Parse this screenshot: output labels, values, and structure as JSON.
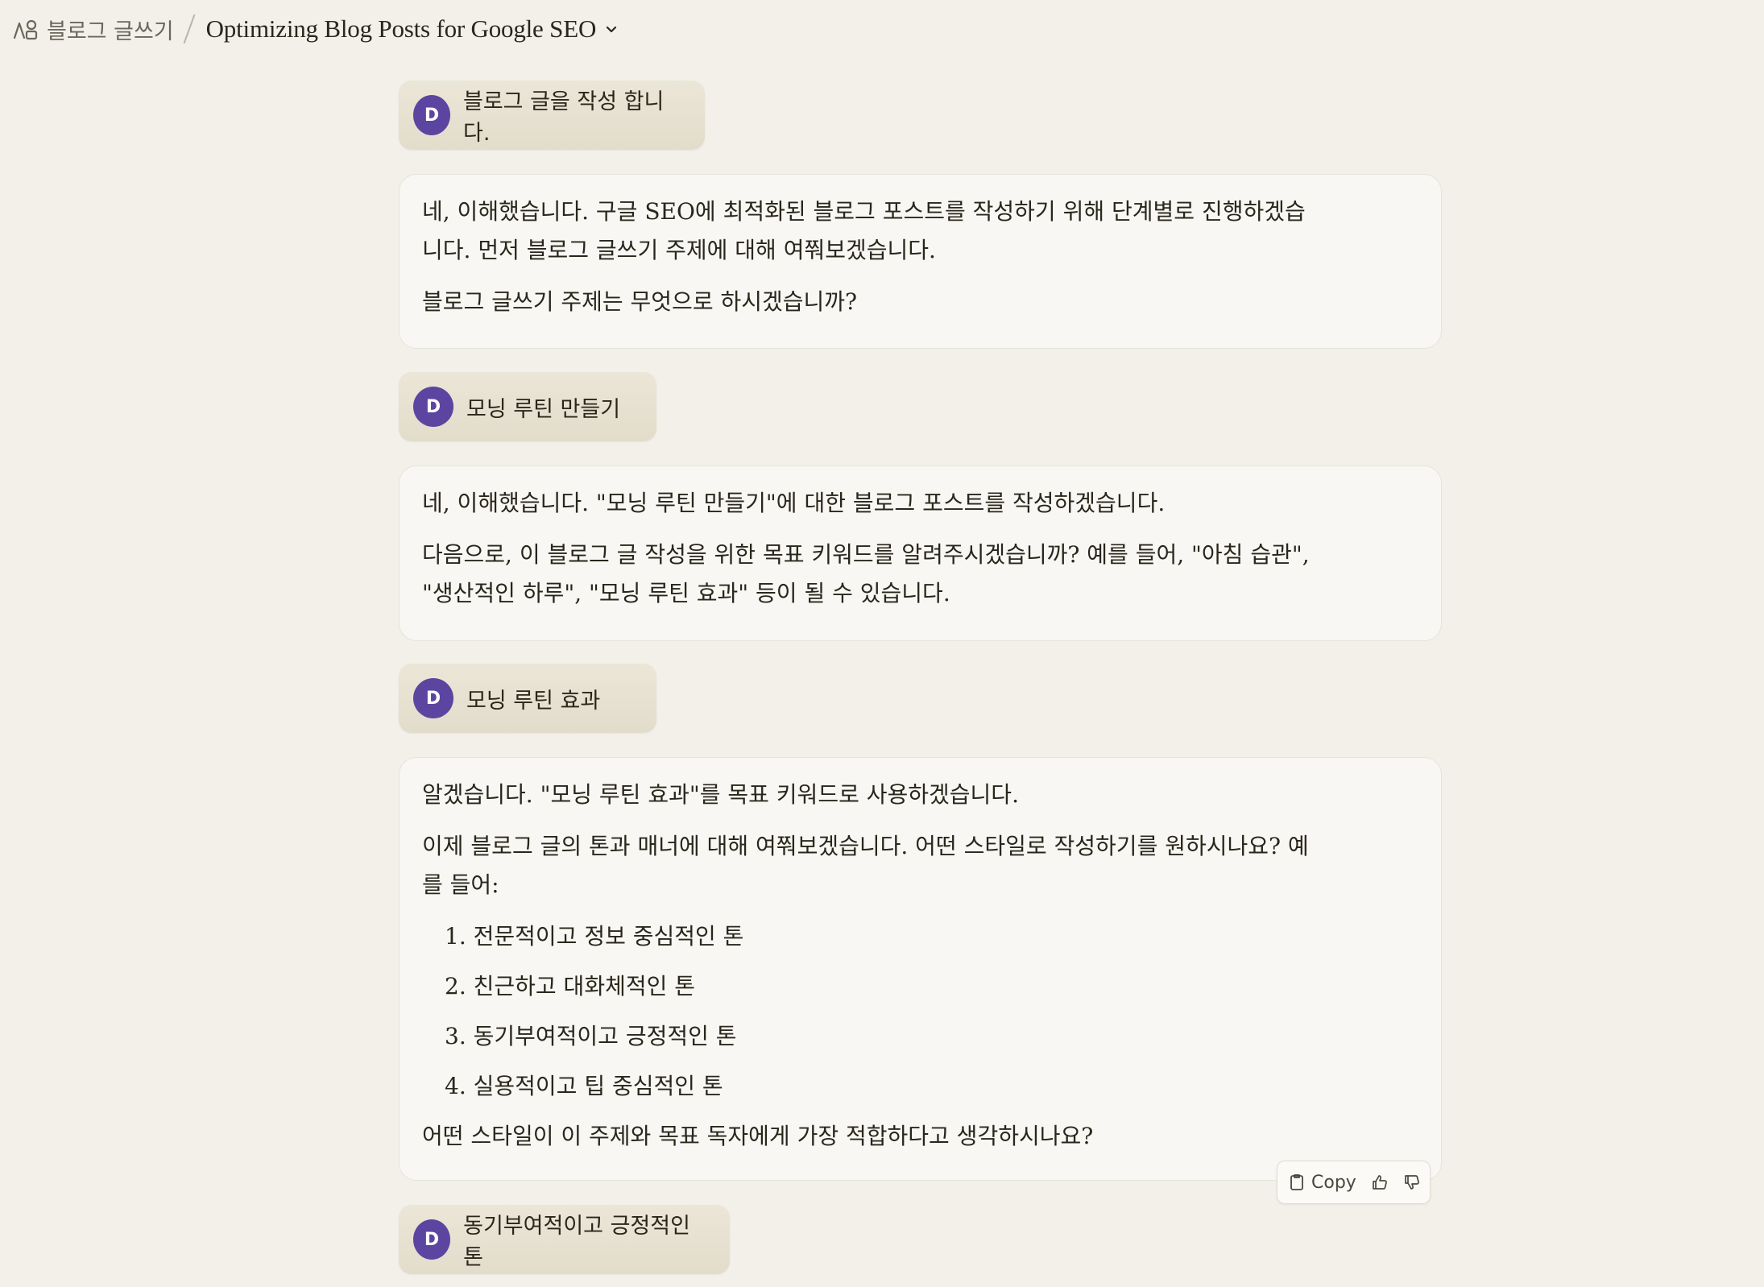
{
  "header": {
    "project_name": "블로그 글쓰기",
    "chat_title": "Optimizing Blog Posts for Google SEO"
  },
  "user_avatar_initial": "D",
  "messages": {
    "user1": "블로그 글을 작성 합니다.",
    "ai1": {
      "p1_line1": "네, 이해했습니다. 구글 SEO에 최적화된 블로그 포스트를 작성하기 위해 단계별로 진행하겠습",
      "p1_line2": "니다. 먼저 블로그 글쓰기 주제에 대해 여쭤보겠습니다.",
      "p2": "블로그 글쓰기 주제는 무엇으로 하시겠습니까?"
    },
    "user2": "모닝 루틴 만들기",
    "ai2": {
      "p1": "네, 이해했습니다. \"모닝 루틴 만들기\"에 대한 블로그 포스트를 작성하겠습니다.",
      "p2_line1": "다음으로, 이 블로그 글 작성을 위한 목표 키워드를 알려주시겠습니까? 예를 들어, \"아침 습관\",",
      "p2_line2": "\"생산적인 하루\", \"모닝 루틴 효과\" 등이 될 수 있습니다."
    },
    "user3": "모닝 루틴 효과",
    "ai3": {
      "p1": "알겠습니다. \"모닝 루틴 효과\"를 목표 키워드로 사용하겠습니다.",
      "p2_line1": "이제 블로그 글의 톤과 매너에 대해 여쭤보겠습니다. 어떤 스타일로 작성하기를 원하시나요? 예",
      "p2_line2": "를 들어:",
      "list": [
        "1. 전문적이고 정보 중심적인 톤",
        "2. 친근하고 대화체적인 톤",
        "3. 동기부여적이고 긍정적인 톤",
        "4. 실용적이고 팁 중심적인 톤"
      ],
      "p3": "어떤 스타일이 이 주제와 목표 독자에게 가장 적합하다고 생각하시나요?"
    },
    "user4": "동기부여적이고 긍정적인 톤"
  },
  "actions": {
    "copy_label": "Copy",
    "icons": [
      "copy-icon",
      "thumbs-up-icon",
      "thumbs-down-icon"
    ]
  },
  "colors": {
    "background": "#f2f0e8",
    "avatar": "#5b45a0",
    "ai_bubble": "#f8f7f3",
    "user_bubble": "#e6e1d1"
  }
}
